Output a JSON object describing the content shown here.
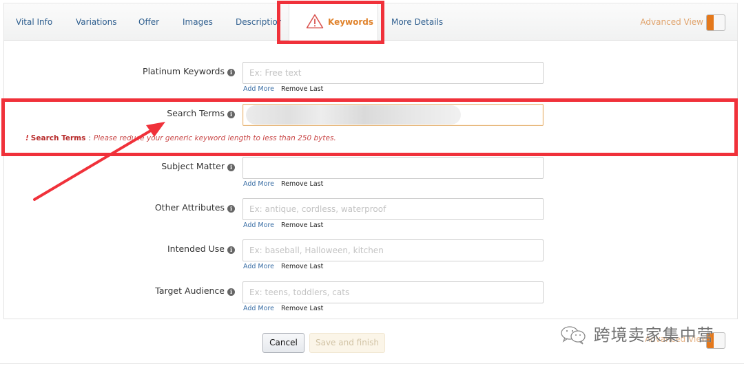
{
  "tabs": [
    {
      "label": "Vital Info"
    },
    {
      "label": "Variations"
    },
    {
      "label": "Offer"
    },
    {
      "label": "Images"
    },
    {
      "label": "Description"
    },
    {
      "label": "Keywords",
      "active": true,
      "icon": "warning-icon"
    },
    {
      "label": "More Details"
    }
  ],
  "advanced_view": {
    "label": "Advanced View",
    "enabled": true
  },
  "colors": {
    "accent_orange": "#e4781b",
    "annotation_red": "#f0313a",
    "error_red": "#cc3333",
    "link_blue": "#3a6ea5"
  },
  "fields": {
    "platinum_keywords": {
      "label": "Platinum Keywords",
      "placeholder": "Ex: Free text",
      "value": ""
    },
    "search_terms": {
      "label": "Search Terms",
      "placeholder": "",
      "value": "",
      "state": "error"
    },
    "subject_matter": {
      "label": "Subject Matter",
      "placeholder": "",
      "value": ""
    },
    "other_attributes": {
      "label": "Other Attributes",
      "placeholder": "Ex: antique, cordless, waterproof",
      "value": ""
    },
    "intended_use": {
      "label": "Intended Use",
      "placeholder": "Ex: baseball, Halloween, kitchen",
      "value": ""
    },
    "target_audience": {
      "label": "Target Audience",
      "placeholder": "Ex: teens, toddlers, cats",
      "value": ""
    }
  },
  "row_links": {
    "add_more": "Add More",
    "remove_last": "Remove Last"
  },
  "info_icon_glyph": "i",
  "error": {
    "bang": "!",
    "field": "Search Terms",
    "separator": ":",
    "message": "Please reduce your generic keyword length to less than 250 bytes."
  },
  "buttons": {
    "cancel": "Cancel",
    "save_and_finish": "Save and finish"
  },
  "watermark": {
    "text": "跨境卖家集中营"
  }
}
